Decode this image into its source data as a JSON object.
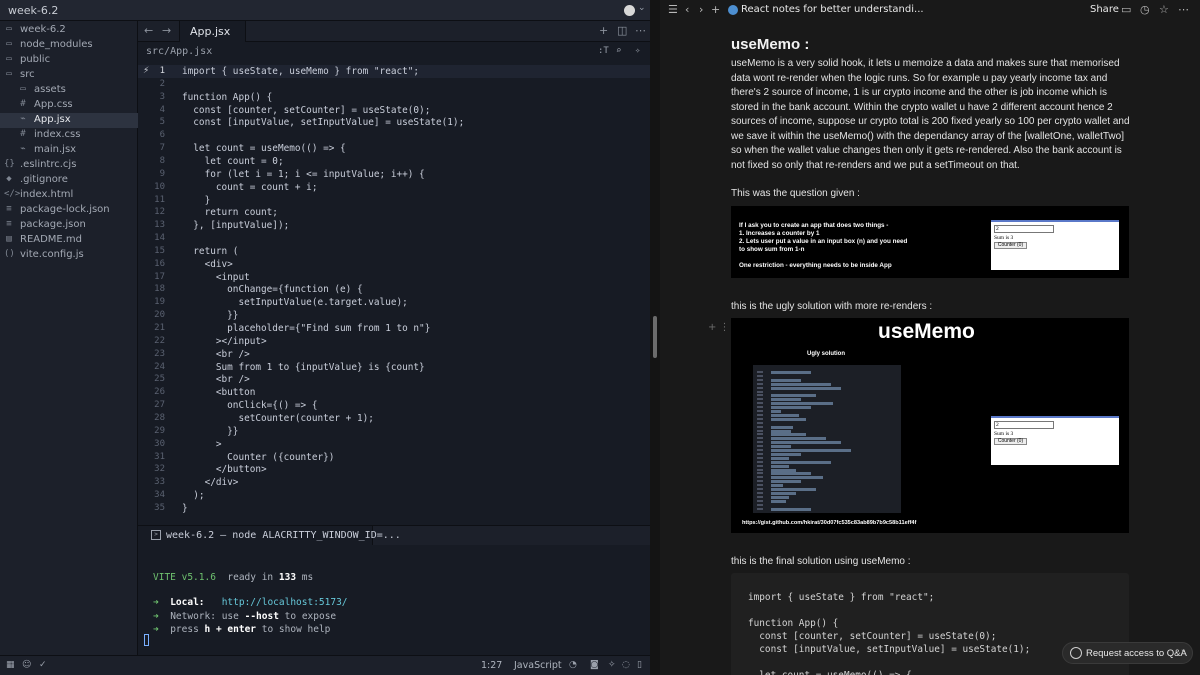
{
  "editor": {
    "project_title": "week-6.2",
    "tree": [
      {
        "label": "node_modules",
        "icon": "folder-icon",
        "glyph": "▭",
        "indent": 1
      },
      {
        "label": "public",
        "icon": "folder-icon",
        "glyph": "▭",
        "indent": 1
      },
      {
        "label": "src",
        "icon": "folder-open-icon",
        "glyph": "▭",
        "indent": 1
      },
      {
        "label": "assets",
        "icon": "folder-icon",
        "glyph": "▭",
        "indent": 2
      },
      {
        "label": "App.css",
        "icon": "css-file-icon",
        "glyph": "#",
        "indent": 2
      },
      {
        "label": "App.jsx",
        "icon": "jsx-file-icon",
        "glyph": "⌁",
        "indent": 2,
        "active": true
      },
      {
        "label": "index.css",
        "icon": "css-file-icon",
        "glyph": "#",
        "indent": 2
      },
      {
        "label": "main.jsx",
        "icon": "jsx-file-icon",
        "glyph": "⌁",
        "indent": 2
      },
      {
        "label": ".eslintrc.cjs",
        "icon": "js-file-icon",
        "glyph": "{}",
        "indent": 1
      },
      {
        "label": ".gitignore",
        "icon": "git-file-icon",
        "glyph": "◆",
        "indent": 1
      },
      {
        "label": "index.html",
        "icon": "html-file-icon",
        "glyph": "</>",
        "indent": 1
      },
      {
        "label": "package-lock.json",
        "icon": "json-file-icon",
        "glyph": "≡",
        "indent": 1
      },
      {
        "label": "package.json",
        "icon": "json-file-icon",
        "glyph": "≡",
        "indent": 1
      },
      {
        "label": "README.md",
        "icon": "markdown-file-icon",
        "glyph": "▤",
        "indent": 1
      },
      {
        "label": "vite.config.js",
        "icon": "js-file-icon",
        "glyph": "()",
        "indent": 1
      }
    ],
    "tab_label": "App.jsx",
    "breadcrumb": "src/App.jsx",
    "current_line": 1,
    "code_lines": [
      "import { useState, useMemo } from \"react\";",
      "",
      "function App() {",
      "  const [counter, setCounter] = useState(0);",
      "  const [inputValue, setInputValue] = useState(1);",
      "",
      "  let count = useMemo(() => {",
      "    let count = 0;",
      "    for (let i = 1; i <= inputValue; i++) {",
      "      count = count + i;",
      "    }",
      "    return count;",
      "  }, [inputValue]);",
      "",
      "  return (",
      "    <div>",
      "      <input",
      "        onChange={function (e) {",
      "          setInputValue(e.target.value);",
      "        }}",
      "        placeholder={\"Find sum from 1 to n\"}",
      "      ></input>",
      "      <br />",
      "      Sum from 1 to {inputValue} is {count}",
      "      <br />",
      "      <button",
      "        onClick={() => {",
      "          setCounter(counter + 1);",
      "        }}",
      "      >",
      "        Counter ({counter})",
      "      </button>",
      "    </div>",
      "  );",
      "}"
    ],
    "terminal_tab": "week-6.2 — node ALACRITTY_WINDOW_ID=...",
    "terminal": {
      "vite": "VITE v5.1.6",
      "ready": "ready in",
      "ready_ms": "133",
      "ready_unit": "ms",
      "arrow": "➜",
      "local_label": "Local:",
      "local_url": "http://localhost:5173/",
      "network_label": "Network:",
      "network_use": "use",
      "network_flag": "--host",
      "network_rest": "to expose",
      "help_press": "press",
      "help_key": "h + enter",
      "help_rest": "to show help"
    },
    "status": {
      "position": "1:27",
      "language": "JavaScript"
    }
  },
  "notes": {
    "page_title": "React notes for better understandi...",
    "share": "Share",
    "heading": "useMemo :",
    "paragraph": "useMemo is a very solid hook, it lets u memoize a data and makes sure that memorised data wont re-render when the logic runs. So for example u pay yearly income tax and there's 2 source of income, 1 is ur crypto income and the other is job income which is stored in the bank account. Within the crypto wallet u have 2 different account hence 2 sources of income, suppose ur crypto total is 200 fixed yearly so 100 per crypto wallet and we save it within the useMemo() with the dependancy array of the [walletOne, walletTwo] so when the wallet value changes then only it gets re-rendered. Also the bank account is not fixed so only that re-renders and we put a setTimeout on that.",
    "question_label": "This was the question given :",
    "question_image": {
      "line1": "If I ask you to create an app that does two things -",
      "line2": "1.  Increases a counter by 1",
      "line3": "2.  Lets user put a value in an input box (n) and you need",
      "line4": "     to show sum from 1-n",
      "line5": "One restriction - everything needs to be inside App",
      "input_value": "2",
      "sum_text": "Sum is 3",
      "counter_button": "Counter (0)"
    },
    "ugly_label": "this is the ugly solution with more re-renders :",
    "ugly_image": {
      "title": "useMemo",
      "subtitle": "Ugly solution",
      "input_value": "2",
      "sum_text": "Sum is 3",
      "counter_button": "Counter (0)",
      "gist_link": "https://gist.github.com/hkirat/30d07fc535c83ab89b7b9c58b11eff4f"
    },
    "final_label": "this is the final solution using useMemo :",
    "code_block": [
      "import { useState } from \"react\";",
      "",
      "function App() {",
      "  const [counter, setCounter] = useState(0);",
      "  const [inputValue, setInputValue] = useState(1);",
      "",
      "  let count = useMemo(() => {"
    ],
    "qa_label": "Request access to Q&A"
  }
}
